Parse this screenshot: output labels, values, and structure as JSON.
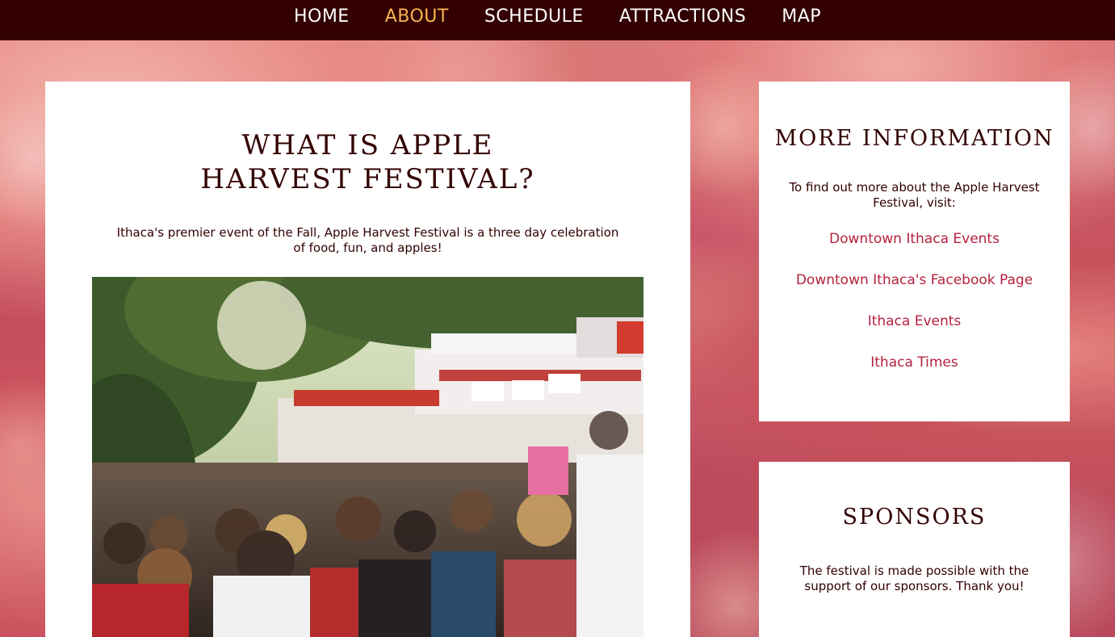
{
  "nav": {
    "items": [
      {
        "label": "HOME",
        "active": false
      },
      {
        "label": "ABOUT",
        "active": true
      },
      {
        "label": "SCHEDULE",
        "active": false
      },
      {
        "label": "ATTRACTIONS",
        "active": false
      },
      {
        "label": "MAP",
        "active": false
      }
    ]
  },
  "main": {
    "title_line1": "WHAT IS APPLE",
    "title_line2": "HARVEST FESTIVAL?",
    "lead": "Ithaca's premier event of the Fall, Apple Harvest Festival is a three day celebration of food, fun, and apples!"
  },
  "more_info": {
    "title": "MORE INFORMATION",
    "text": "To find out more about the Apple Harvest Festival, visit:",
    "links": [
      "Downtown Ithaca Events",
      "Downtown Ithaca's Facebook Page",
      "Ithaca Events",
      "Ithaca Times"
    ]
  },
  "sponsors": {
    "title": "SPONSORS",
    "text": "The festival is made possible with the support of our sponsors. Thank you!"
  },
  "colors": {
    "nav_bg": "#320000",
    "nav_active": "#f6b451",
    "heading": "#320000",
    "link": "#b5213f"
  }
}
